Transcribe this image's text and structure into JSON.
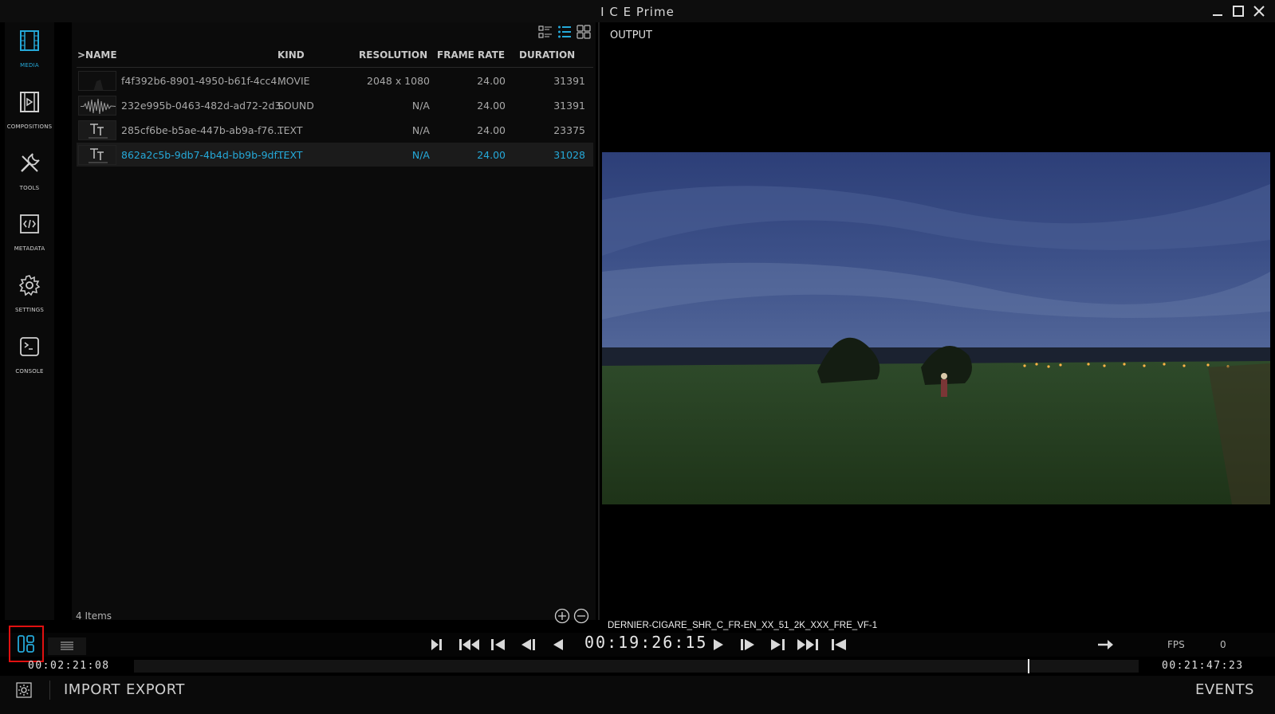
{
  "window": {
    "title": "I C E Prime"
  },
  "sidebar": {
    "items": [
      {
        "label": "MEDIA",
        "icon": "film-icon",
        "active": true
      },
      {
        "label": "COMPOSITIONS",
        "icon": "composition-icon"
      },
      {
        "label": "TOOLS",
        "icon": "tools-icon"
      },
      {
        "label": "METADATA",
        "icon": "code-icon"
      },
      {
        "label": "SETTINGS",
        "icon": "gear-icon"
      },
      {
        "label": "CONSOLE",
        "icon": "terminal-icon"
      }
    ]
  },
  "media": {
    "columns": {
      "name": ">NAME",
      "kind": "KIND",
      "resolution": "RESOLUTION",
      "frame_rate": "FRAME RATE",
      "duration": "DURATION"
    },
    "rows": [
      {
        "name": "f4f392b6-8901-4950-b61f-4cc4...",
        "kind": "MOVIE",
        "resolution": "2048 x 1080",
        "frame_rate": "24.00",
        "duration": "31391",
        "thumb": "movie"
      },
      {
        "name": "232e995b-0463-482d-ad72-2d3...",
        "kind": "SOUND",
        "resolution": "N/A",
        "frame_rate": "24.00",
        "duration": "31391",
        "thumb": "sound"
      },
      {
        "name": "285cf6be-b5ae-447b-ab9a-f76...",
        "kind": "TEXT",
        "resolution": "N/A",
        "frame_rate": "24.00",
        "duration": "23375",
        "thumb": "text"
      },
      {
        "name": "862a2c5b-9db7-4b4d-bb9b-9df...",
        "kind": "TEXT",
        "resolution": "N/A",
        "frame_rate": "24.00",
        "duration": "31028",
        "thumb": "text",
        "selected": true
      }
    ],
    "items_count": "4 Items"
  },
  "output": {
    "label": "OUTPUT",
    "clip_name": "DERNIER-CIGARE_SHR_C_FR-EN_XX_51_2K_XXX_FRE_VF-1"
  },
  "transport": {
    "timecode": "00:19:26:15",
    "fps_label": "FPS",
    "fps_value": "0"
  },
  "timeline": {
    "start_tc": "00:02:21:08",
    "end_tc": "00:21:47:23",
    "playhead_fraction": 0.89
  },
  "bottom": {
    "import_label": "IMPORT",
    "export_label": "EXPORT",
    "events_label": "EVENTS"
  },
  "colors": {
    "accent": "#25a9d9",
    "highlight_box": "#e01010"
  }
}
